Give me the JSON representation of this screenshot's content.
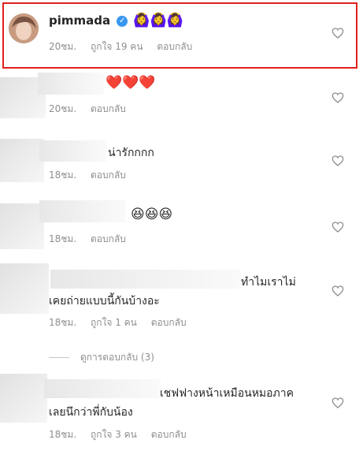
{
  "comments": [
    {
      "username": "pimmada",
      "text": "🙆‍♀️🙆‍♀️🙆‍♀️",
      "time": "20ชม.",
      "likes": "ถูกใจ 19 คน",
      "reply": "ตอบกลับ"
    },
    {
      "text": "❤️❤️❤️",
      "time": "20ชม.",
      "reply": "ตอบกลับ"
    },
    {
      "text": "น่ารักกกก",
      "time": "18ชม.",
      "reply": "ตอบกลับ"
    },
    {
      "text": "😆😆😆",
      "time": "18ชม.",
      "reply": "ตอบกลับ"
    },
    {
      "text_line1": "ทำไมเราไม่",
      "text_line2": "เคยถ่ายแบบนี้กันบ้างอะ",
      "time": "18ชม.",
      "likes": "ถูกใจ 1 คน",
      "reply": "ตอบกลับ",
      "view_replies": "ดูการตอบกลับ (3)"
    },
    {
      "text_line1": "เชฟฟางหน้าเหมือนหมอภาค",
      "text_line2": "เลยนึกว่าพี่กับน้อง",
      "time": "18ชม.",
      "likes": "ถูกใจ 3 คน",
      "reply": "ตอบกลับ"
    }
  ],
  "icons": {
    "like": "heart-outline-icon",
    "verified": "verified-badge-icon"
  },
  "colors": {
    "highlight_border": "#e0201b",
    "verified_blue": "#3897f0",
    "meta_gray": "#8e8e8e",
    "text": "#262626"
  }
}
